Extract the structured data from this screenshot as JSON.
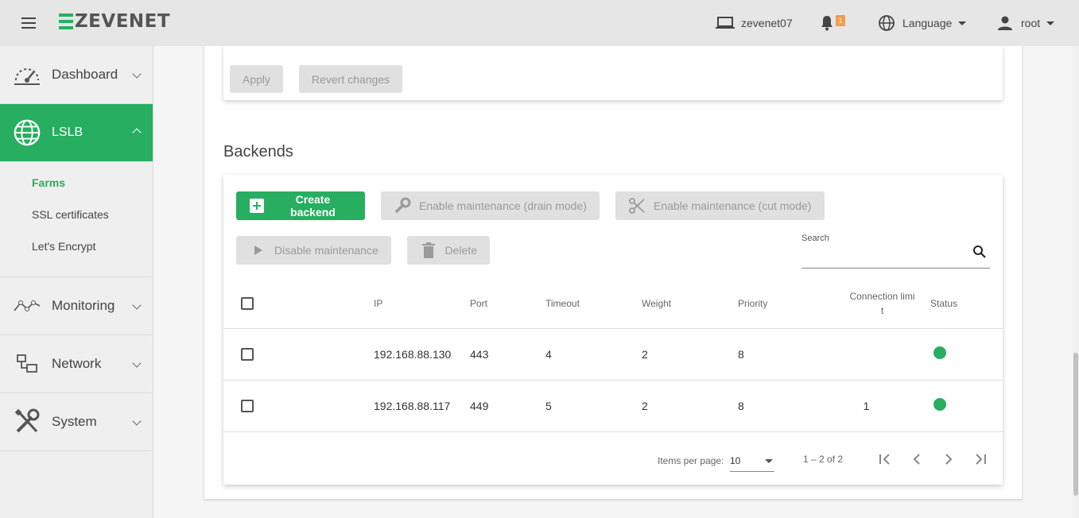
{
  "header": {
    "logo": "ZEVENET",
    "hostname": "zevenet07",
    "notifications_count": "1",
    "language_label": "Language",
    "user_label": "root"
  },
  "sidebar": {
    "items": [
      {
        "label": "Dashboard",
        "icon": "dashboard-icon"
      },
      {
        "label": "LSLB",
        "icon": "globe-icon",
        "active": true
      },
      {
        "label": "Monitoring",
        "icon": "monitoring-icon"
      },
      {
        "label": "Network",
        "icon": "network-icon"
      },
      {
        "label": "System",
        "icon": "tools-icon"
      }
    ],
    "lslb_sub": [
      {
        "label": "Farms",
        "active": true
      },
      {
        "label": "SSL certificates"
      },
      {
        "label": "Let's Encrypt"
      }
    ]
  },
  "top_card": {
    "apply_label": "Apply",
    "revert_label": "Revert changes"
  },
  "backends": {
    "title": "Backends",
    "buttons": {
      "create": "Create backend",
      "drain": "Enable maintenance (drain mode)",
      "cut": "Enable maintenance (cut mode)",
      "disable": "Disable maintenance",
      "delete": "Delete"
    },
    "search_label": "Search",
    "search_value": "",
    "columns": {
      "ip": "IP",
      "port": "Port",
      "timeout": "Timeout",
      "weight": "Weight",
      "priority": "Priority",
      "connlimit_1": "Connection limi",
      "connlimit_2": "t",
      "status": "Status"
    },
    "rows": [
      {
        "ip": "192.168.88.130",
        "port": "443",
        "timeout": "4",
        "weight": "2",
        "priority": "8",
        "connlimit": "",
        "status_color": "#27ae60"
      },
      {
        "ip": "192.168.88.117",
        "port": "449",
        "timeout": "5",
        "weight": "2",
        "priority": "8",
        "connlimit": "1",
        "status_color": "#27ae60"
      }
    ],
    "paginator": {
      "items_per_page_label": "Items per page:",
      "items_per_page_value": "10",
      "range_label": "1 – 2 of 2"
    }
  },
  "colors": {
    "accent": "#27ae60",
    "badge": "#f39c4c"
  }
}
